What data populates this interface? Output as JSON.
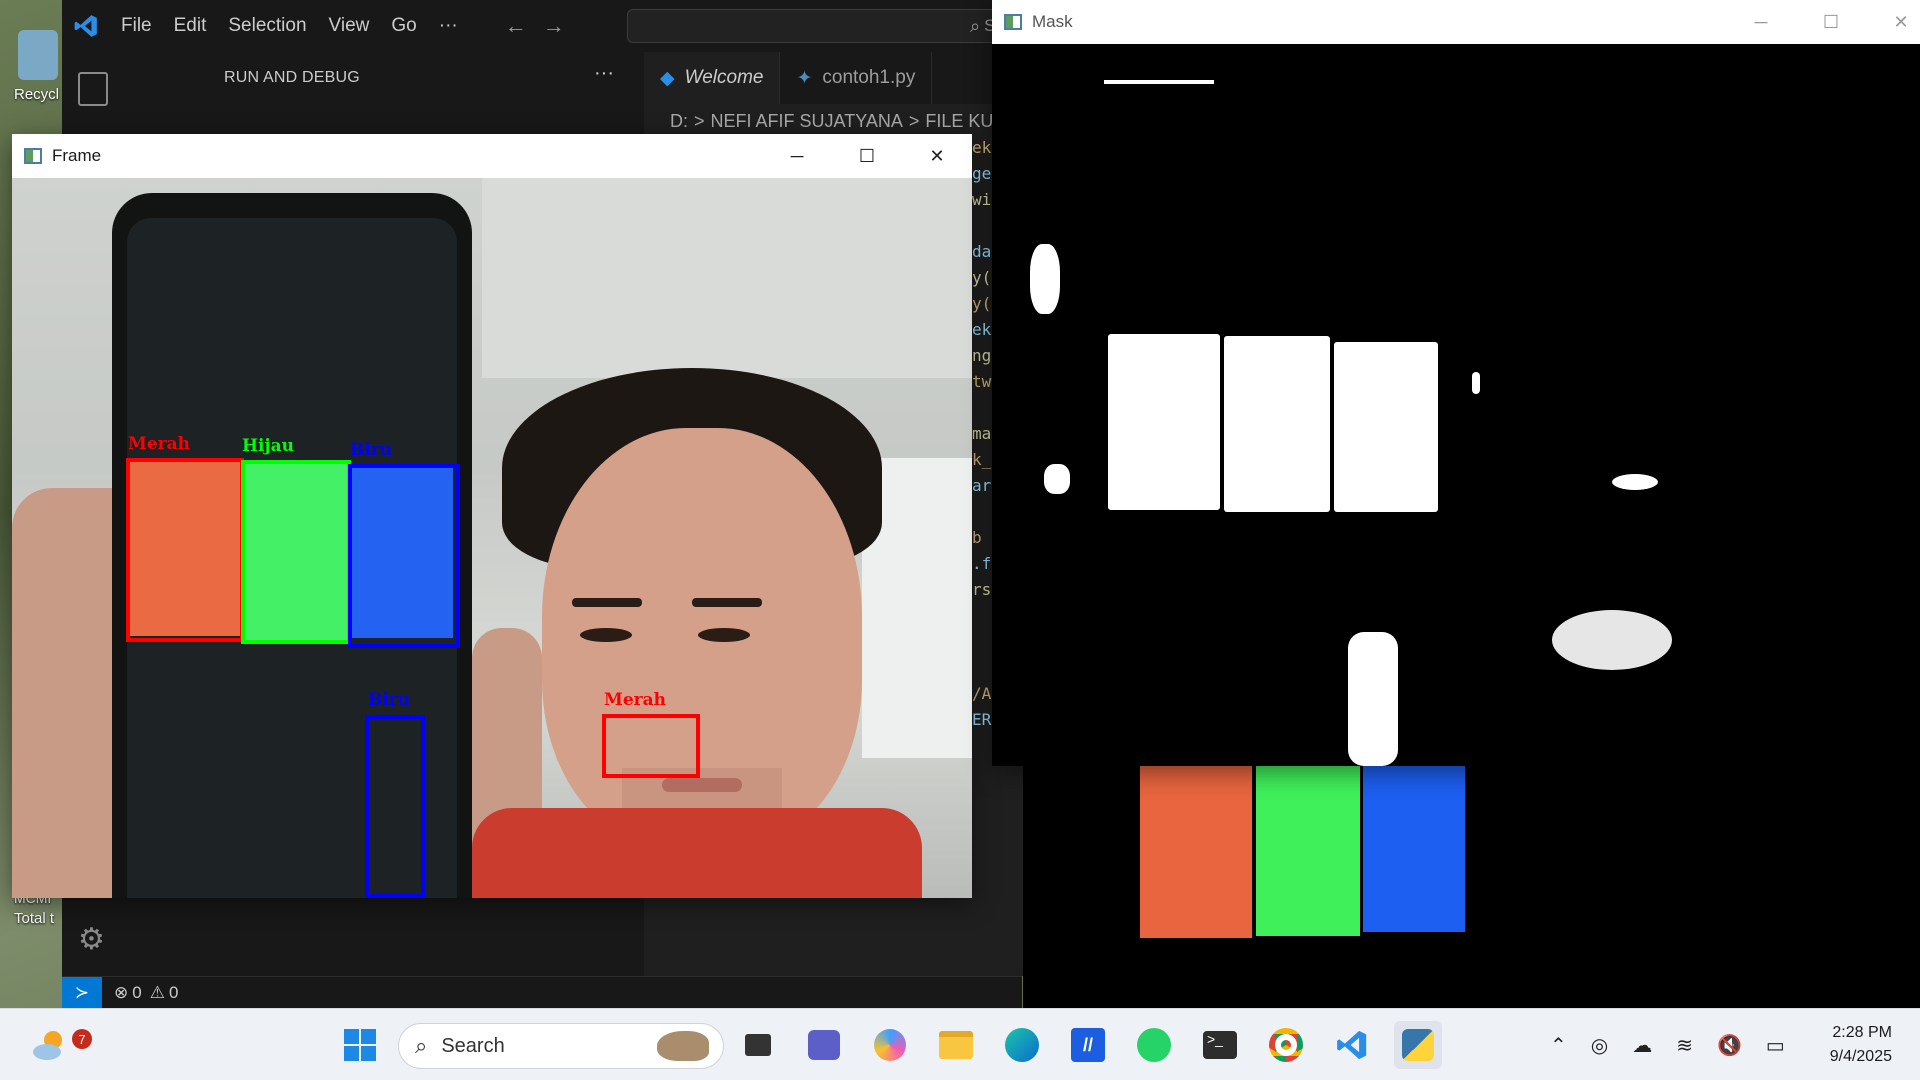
{
  "desktop": {
    "icon_recycle_label": "Recycl",
    "icon_second_label": "Total t",
    "icon_second_label_top": "MCMI"
  },
  "vscode": {
    "menu": [
      "File",
      "Edit",
      "Selection",
      "View",
      "Go",
      "···"
    ],
    "search_placeholder": "Sear",
    "sidebar_title": "RUN AND DEBUG",
    "sidebar_more": "···",
    "tabs": [
      {
        "label": "Welcome",
        "active": true
      },
      {
        "label": "contoh1.py",
        "active": false
      }
    ],
    "breadcrumb": [
      "D:",
      ">",
      "NEFI AFIF SUJATYANA",
      ">",
      "FILE KULIAH",
      ">",
      "S"
    ],
    "code_fragments": [
      "ek",
      "ge",
      "wi",
      "",
      "da",
      "y(",
      "y(",
      "ek",
      "ng",
      "tw",
      "",
      "ma",
      "k_",
      "ar",
      "",
      "b",
      ".f",
      "rs",
      "",
      "",
      "",
      "/A",
      "ER"
    ],
    "status": {
      "errors": "0",
      "warnings": "0"
    }
  },
  "frame_window": {
    "title": "Frame",
    "detections": [
      {
        "label": "Merah",
        "color": "#ff0000"
      },
      {
        "label": "Hijau",
        "color": "#00ff00"
      },
      {
        "label": "Biru",
        "color": "#0000ff"
      },
      {
        "label": "Biru",
        "color": "#0000ff"
      },
      {
        "label": "Merah",
        "color": "#ff0000"
      }
    ]
  },
  "mask_window": {
    "title": "Mask"
  },
  "taskbar": {
    "search_label": "Search",
    "weather_badge": "7",
    "time": "2:28 PM",
    "date": "9/4/2025"
  },
  "colors": {
    "vscode_bg": "#1f1f1f",
    "vscode_accent": "#0078d4",
    "detect_red": "#ff0000",
    "detect_green": "#00ff00",
    "detect_blue": "#0000ff"
  }
}
